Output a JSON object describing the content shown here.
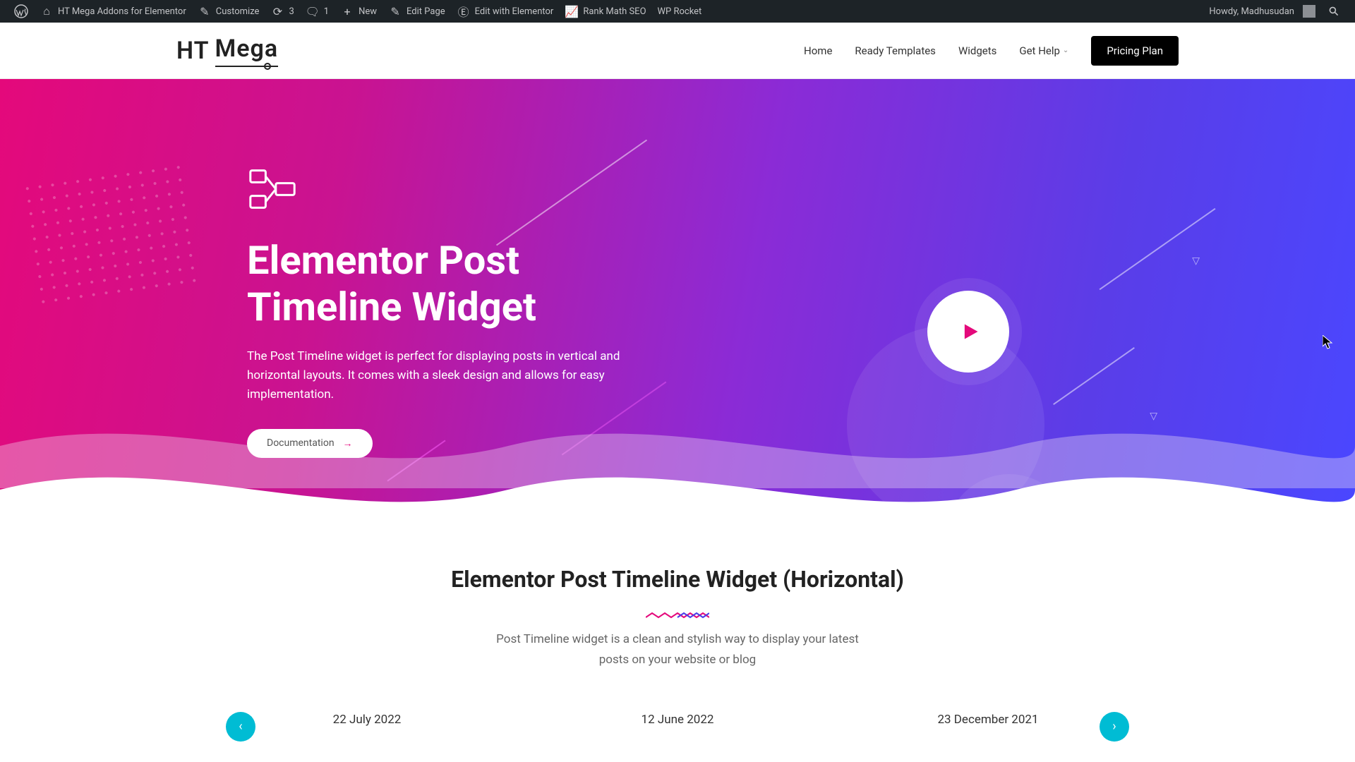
{
  "adminbar": {
    "left": [
      {
        "icon": "wordpress-icon",
        "label": ""
      },
      {
        "icon": "site-icon",
        "label": "HT Mega Addons for Elementor"
      },
      {
        "icon": "customize-icon",
        "label": "Customize"
      },
      {
        "icon": "updates-icon",
        "label": "3"
      },
      {
        "icon": "comment-icon",
        "label": "1"
      },
      {
        "icon": "plus-icon",
        "label": "New"
      },
      {
        "icon": "edit-icon",
        "label": "Edit Page"
      },
      {
        "icon": "elementor-icon",
        "label": "Edit with Elementor"
      },
      {
        "icon": "rank-icon",
        "label": "Rank Math SEO"
      },
      {
        "icon": "",
        "label": "WP Rocket"
      }
    ],
    "greeting": "Howdy, Madhusudan"
  },
  "nav": {
    "items": [
      "Home",
      "Ready Templates",
      "Widgets",
      "Get Help"
    ],
    "pricing": "Pricing Plan"
  },
  "hero": {
    "title": "Elementor Post Timeline Widget",
    "desc": "The Post Timeline widget is perfect for displaying posts in vertical and horizontal layouts. It comes with a sleek design and allows for easy implementation.",
    "doc_btn": "Documentation"
  },
  "section": {
    "title": "Elementor Post Timeline Widget (Horizontal)",
    "desc": "Post Timeline widget is a clean and stylish way to display your latest posts on your website or blog"
  },
  "timeline": {
    "dates": [
      "22 July 2022",
      "12 June 2022",
      "23 December 2021"
    ]
  },
  "colors": {
    "accent_pink": "#e4097b",
    "accent_purple": "#7b2ff7",
    "accent_cyan": "#00bcd4"
  }
}
